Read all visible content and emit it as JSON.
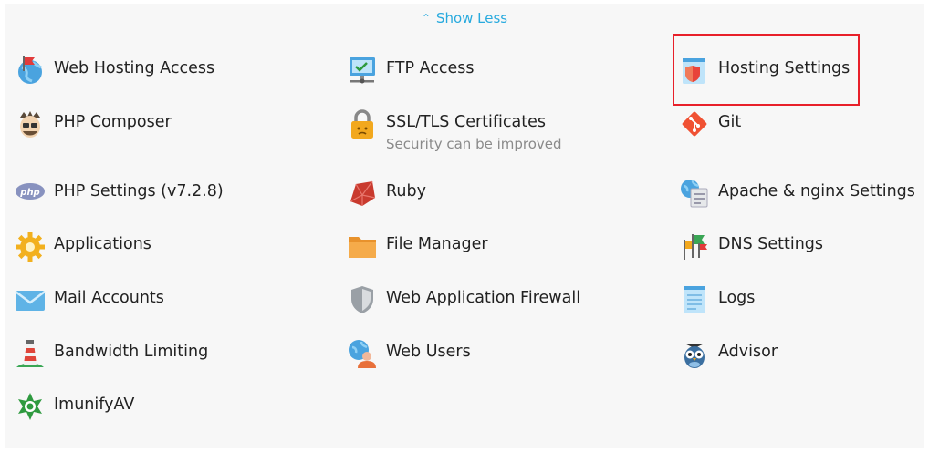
{
  "header": {
    "show_less_label": "Show Less",
    "show_less_icon": "chevron-up-icon"
  },
  "accent_color": "#28aade",
  "highlight_color": "#e8202a",
  "tools": {
    "web_hosting_access": {
      "label": "Web Hosting Access",
      "icon": "globe-flag-icon"
    },
    "ftp_access": {
      "label": "FTP Access",
      "icon": "ftp-monitor-icon"
    },
    "hosting_settings": {
      "label": "Hosting Settings",
      "icon": "hosting-settings-icon"
    },
    "php_composer": {
      "label": "PHP Composer",
      "icon": "composer-icon"
    },
    "ssl_tls": {
      "label": "SSL/TLS Certificates",
      "sublabel": "Security can be improved",
      "icon": "padlock-icon"
    },
    "git": {
      "label": "Git",
      "icon": "git-icon"
    },
    "php_settings": {
      "label": "PHP Settings (v7.2.8)",
      "icon": "php-icon"
    },
    "ruby": {
      "label": "Ruby",
      "icon": "ruby-icon"
    },
    "apache_nginx": {
      "label": "Apache & nginx Settings",
      "icon": "server-globe-icon"
    },
    "applications": {
      "label": "Applications",
      "icon": "gear-icon"
    },
    "file_manager": {
      "label": "File Manager",
      "icon": "folder-icon"
    },
    "dns_settings": {
      "label": "DNS Settings",
      "icon": "dns-flags-icon"
    },
    "mail_accounts": {
      "label": "Mail Accounts",
      "icon": "envelope-icon"
    },
    "waf": {
      "label": "Web Application Firewall",
      "icon": "shield-icon"
    },
    "logs": {
      "label": "Logs",
      "icon": "log-document-icon"
    },
    "bandwidth_limiting": {
      "label": "Bandwidth Limiting",
      "icon": "lighthouse-icon"
    },
    "web_users": {
      "label": "Web Users",
      "icon": "web-user-icon"
    },
    "advisor": {
      "label": "Advisor",
      "icon": "owl-icon"
    },
    "imunifyav": {
      "label": "ImunifyAV",
      "icon": "imunify-icon"
    }
  }
}
